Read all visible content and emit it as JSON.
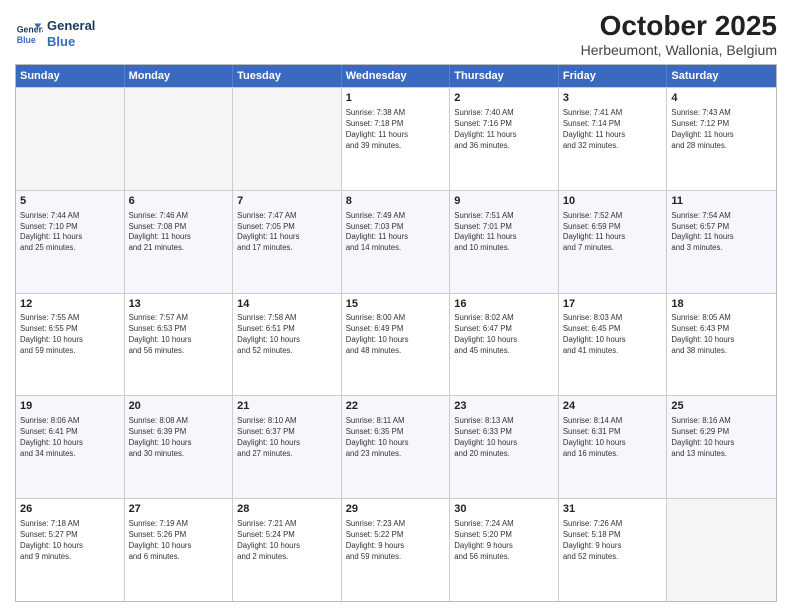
{
  "logo": {
    "line1": "General",
    "line2": "Blue"
  },
  "title": "October 2025",
  "subtitle": "Herbeumont, Wallonia, Belgium",
  "weekdays": [
    "Sunday",
    "Monday",
    "Tuesday",
    "Wednesday",
    "Thursday",
    "Friday",
    "Saturday"
  ],
  "rows": [
    [
      {
        "day": "",
        "info": "",
        "empty": true
      },
      {
        "day": "",
        "info": "",
        "empty": true
      },
      {
        "day": "",
        "info": "",
        "empty": true
      },
      {
        "day": "1",
        "info": "Sunrise: 7:38 AM\nSunset: 7:18 PM\nDaylight: 11 hours\nand 39 minutes.",
        "empty": false
      },
      {
        "day": "2",
        "info": "Sunrise: 7:40 AM\nSunset: 7:16 PM\nDaylight: 11 hours\nand 36 minutes.",
        "empty": false
      },
      {
        "day": "3",
        "info": "Sunrise: 7:41 AM\nSunset: 7:14 PM\nDaylight: 11 hours\nand 32 minutes.",
        "empty": false
      },
      {
        "day": "4",
        "info": "Sunrise: 7:43 AM\nSunset: 7:12 PM\nDaylight: 11 hours\nand 28 minutes.",
        "empty": false
      }
    ],
    [
      {
        "day": "5",
        "info": "Sunrise: 7:44 AM\nSunset: 7:10 PM\nDaylight: 11 hours\nand 25 minutes.",
        "empty": false
      },
      {
        "day": "6",
        "info": "Sunrise: 7:46 AM\nSunset: 7:08 PM\nDaylight: 11 hours\nand 21 minutes.",
        "empty": false
      },
      {
        "day": "7",
        "info": "Sunrise: 7:47 AM\nSunset: 7:05 PM\nDaylight: 11 hours\nand 17 minutes.",
        "empty": false
      },
      {
        "day": "8",
        "info": "Sunrise: 7:49 AM\nSunset: 7:03 PM\nDaylight: 11 hours\nand 14 minutes.",
        "empty": false
      },
      {
        "day": "9",
        "info": "Sunrise: 7:51 AM\nSunset: 7:01 PM\nDaylight: 11 hours\nand 10 minutes.",
        "empty": false
      },
      {
        "day": "10",
        "info": "Sunrise: 7:52 AM\nSunset: 6:59 PM\nDaylight: 11 hours\nand 7 minutes.",
        "empty": false
      },
      {
        "day": "11",
        "info": "Sunrise: 7:54 AM\nSunset: 6:57 PM\nDaylight: 11 hours\nand 3 minutes.",
        "empty": false
      }
    ],
    [
      {
        "day": "12",
        "info": "Sunrise: 7:55 AM\nSunset: 6:55 PM\nDaylight: 10 hours\nand 59 minutes.",
        "empty": false
      },
      {
        "day": "13",
        "info": "Sunrise: 7:57 AM\nSunset: 6:53 PM\nDaylight: 10 hours\nand 56 minutes.",
        "empty": false
      },
      {
        "day": "14",
        "info": "Sunrise: 7:58 AM\nSunset: 6:51 PM\nDaylight: 10 hours\nand 52 minutes.",
        "empty": false
      },
      {
        "day": "15",
        "info": "Sunrise: 8:00 AM\nSunset: 6:49 PM\nDaylight: 10 hours\nand 48 minutes.",
        "empty": false
      },
      {
        "day": "16",
        "info": "Sunrise: 8:02 AM\nSunset: 6:47 PM\nDaylight: 10 hours\nand 45 minutes.",
        "empty": false
      },
      {
        "day": "17",
        "info": "Sunrise: 8:03 AM\nSunset: 6:45 PM\nDaylight: 10 hours\nand 41 minutes.",
        "empty": false
      },
      {
        "day": "18",
        "info": "Sunrise: 8:05 AM\nSunset: 6:43 PM\nDaylight: 10 hours\nand 38 minutes.",
        "empty": false
      }
    ],
    [
      {
        "day": "19",
        "info": "Sunrise: 8:06 AM\nSunset: 6:41 PM\nDaylight: 10 hours\nand 34 minutes.",
        "empty": false
      },
      {
        "day": "20",
        "info": "Sunrise: 8:08 AM\nSunset: 6:39 PM\nDaylight: 10 hours\nand 30 minutes.",
        "empty": false
      },
      {
        "day": "21",
        "info": "Sunrise: 8:10 AM\nSunset: 6:37 PM\nDaylight: 10 hours\nand 27 minutes.",
        "empty": false
      },
      {
        "day": "22",
        "info": "Sunrise: 8:11 AM\nSunset: 6:35 PM\nDaylight: 10 hours\nand 23 minutes.",
        "empty": false
      },
      {
        "day": "23",
        "info": "Sunrise: 8:13 AM\nSunset: 6:33 PM\nDaylight: 10 hours\nand 20 minutes.",
        "empty": false
      },
      {
        "day": "24",
        "info": "Sunrise: 8:14 AM\nSunset: 6:31 PM\nDaylight: 10 hours\nand 16 minutes.",
        "empty": false
      },
      {
        "day": "25",
        "info": "Sunrise: 8:16 AM\nSunset: 6:29 PM\nDaylight: 10 hours\nand 13 minutes.",
        "empty": false
      }
    ],
    [
      {
        "day": "26",
        "info": "Sunrise: 7:18 AM\nSunset: 5:27 PM\nDaylight: 10 hours\nand 9 minutes.",
        "empty": false
      },
      {
        "day": "27",
        "info": "Sunrise: 7:19 AM\nSunset: 5:26 PM\nDaylight: 10 hours\nand 6 minutes.",
        "empty": false
      },
      {
        "day": "28",
        "info": "Sunrise: 7:21 AM\nSunset: 5:24 PM\nDaylight: 10 hours\nand 2 minutes.",
        "empty": false
      },
      {
        "day": "29",
        "info": "Sunrise: 7:23 AM\nSunset: 5:22 PM\nDaylight: 9 hours\nand 59 minutes.",
        "empty": false
      },
      {
        "day": "30",
        "info": "Sunrise: 7:24 AM\nSunset: 5:20 PM\nDaylight: 9 hours\nand 56 minutes.",
        "empty": false
      },
      {
        "day": "31",
        "info": "Sunrise: 7:26 AM\nSunset: 5:18 PM\nDaylight: 9 hours\nand 52 minutes.",
        "empty": false
      },
      {
        "day": "",
        "info": "",
        "empty": true
      }
    ]
  ]
}
